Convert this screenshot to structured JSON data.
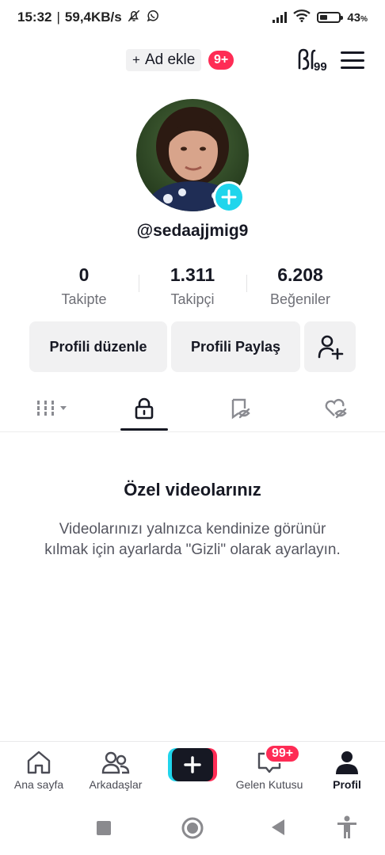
{
  "status_bar": {
    "time": "15:32",
    "network_speed": "59,4KB/s",
    "battery_percent": "43",
    "battery_unit": "%",
    "battery_level": 0.43,
    "icons": [
      "bell-off-icon",
      "whatsapp-icon",
      "signal-icon",
      "wifi-icon",
      "battery-icon"
    ]
  },
  "top_nav": {
    "add_account_plus": "+",
    "add_account_label": "Ad ekle",
    "notification_count": "9+",
    "icons": [
      "creator-tools-icon",
      "hamburger-menu-icon"
    ]
  },
  "profile": {
    "username": "@sedaajjmig9",
    "stats": [
      {
        "value": "0",
        "label": "Takipte"
      },
      {
        "value": "1.311",
        "label": "Takipçi"
      },
      {
        "value": "6.208",
        "label": "Beğeniler"
      }
    ]
  },
  "actions": {
    "edit_profile": "Profili düzenle",
    "share_profile": "Profili Paylaş",
    "add_friend_icon": "add-friend-icon"
  },
  "tabs": [
    {
      "name": "videos-grid",
      "icon": "grid-icon"
    },
    {
      "name": "private",
      "icon": "lock-icon",
      "active": true
    },
    {
      "name": "saved",
      "icon": "bookmark-hidden-icon"
    },
    {
      "name": "liked",
      "icon": "heart-hidden-icon"
    }
  ],
  "empty_state": {
    "title": "Özel videolarınız",
    "description": "Videolarınızı yalnızca kendinize görünür kılmak için ayarlarda \"Gizli\" olarak ayarlayın."
  },
  "bottom_nav": {
    "home": "Ana sayfa",
    "friends": "Arkadaşlar",
    "inbox": "Gelen Kutusu",
    "inbox_badge": "99+",
    "profile": "Profil"
  },
  "colors": {
    "accent_red": "#fe2c55",
    "accent_cyan": "#20d5ec",
    "text_primary": "#161823",
    "surface": "#f1f1f2"
  }
}
